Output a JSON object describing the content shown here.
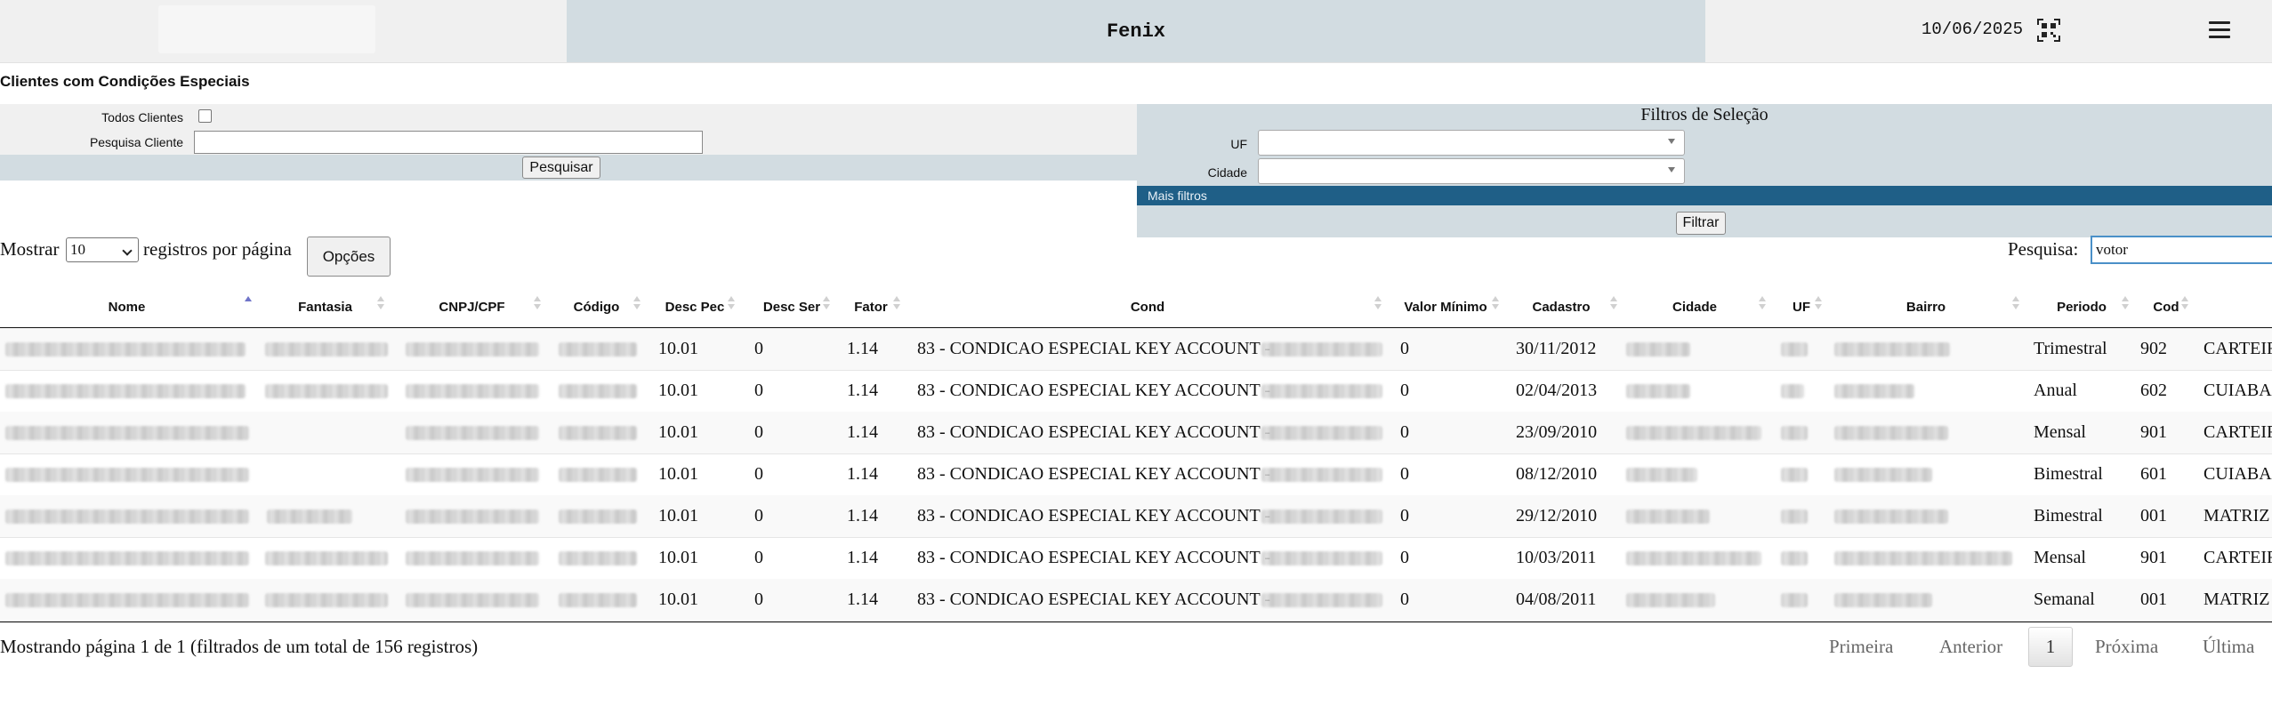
{
  "header": {
    "app_title": "Fenix",
    "date": "10/06/2025"
  },
  "page_title": "Clientes com Condições Especiais",
  "filters_left": {
    "todos_label": "Todos Clientes",
    "pesquisa_label": "Pesquisa Cliente",
    "pesquisa_value": "",
    "pesquisar_button": "Pesquisar"
  },
  "filters_right": {
    "title": "Filtros de Seleção",
    "uf_label": "UF",
    "cidade_label": "Cidade",
    "mais_filtros": "Mais filtros",
    "filtrar_button": "Filtrar"
  },
  "table_controls": {
    "show_prefix": "Mostrar",
    "page_length": "10",
    "show_suffix": "registros por página",
    "options_button": "Opções",
    "search_label": "Pesquisa:",
    "search_value": "votor"
  },
  "table": {
    "columns": [
      "Nome",
      "Fantasia",
      "CNPJ/CPF",
      "Código",
      "Desc Pec",
      "Desc Ser",
      "Fator",
      "Cond",
      "Valor Mínimo",
      "Cadastro",
      "Cidade",
      "UF",
      "Bairro",
      "Periodo",
      "Cod"
    ],
    "sorted_column": "Nome",
    "rows": [
      {
        "desc_pec": "10.01",
        "desc_ser": "0",
        "fator": "1.14",
        "cond": "83 - CONDICAO ESPECIAL KEY ACCOUNT -",
        "valor_minimo": "0",
        "cadastro": "30/11/2012",
        "periodo": "Trimestral",
        "cod": "902",
        "last": "CARTEIRA"
      },
      {
        "desc_pec": "10.01",
        "desc_ser": "0",
        "fator": "1.14",
        "cond": "83 - CONDICAO ESPECIAL KEY ACCOUNT -",
        "valor_minimo": "0",
        "cadastro": "02/04/2013",
        "periodo": "Anual",
        "cod": "602",
        "last": "CUIABA"
      },
      {
        "desc_pec": "10.01",
        "desc_ser": "0",
        "fator": "1.14",
        "cond": "83 - CONDICAO ESPECIAL KEY ACCOUNT -",
        "valor_minimo": "0",
        "cadastro": "23/09/2010",
        "periodo": "Mensal",
        "cod": "901",
        "last": "CARTEIRA"
      },
      {
        "desc_pec": "10.01",
        "desc_ser": "0",
        "fator": "1.14",
        "cond": "83 - CONDICAO ESPECIAL KEY ACCOUNT -",
        "valor_minimo": "0",
        "cadastro": "08/12/2010",
        "periodo": "Bimestral",
        "cod": "601",
        "last": "CUIABA"
      },
      {
        "desc_pec": "10.01",
        "desc_ser": "0",
        "fator": "1.14",
        "cond": "83 - CONDICAO ESPECIAL KEY ACCOUNT -",
        "valor_minimo": "0",
        "cadastro": "29/12/2010",
        "periodo": "Bimestral",
        "cod": "001",
        "last": "MATRIZ"
      },
      {
        "desc_pec": "10.01",
        "desc_ser": "0",
        "fator": "1.14",
        "cond": "83 - CONDICAO ESPECIAL KEY ACCOUNT -",
        "valor_minimo": "0",
        "cadastro": "10/03/2011",
        "periodo": "Mensal",
        "cod": "901",
        "last": "CARTEIRA"
      },
      {
        "desc_pec": "10.01",
        "desc_ser": "0",
        "fator": "1.14",
        "cond": "83 - CONDICAO ESPECIAL KEY ACCOUNT -",
        "valor_minimo": "0",
        "cadastro": "04/08/2011",
        "periodo": "Semanal",
        "cod": "001",
        "last": "MATRIZ"
      }
    ]
  },
  "footer": {
    "info": "Mostrando página 1 de 1 (filtrados de um total de 156 registros)",
    "first": "Primeira",
    "previous": "Anterior",
    "current": "1",
    "next": "Próxima",
    "last": "Última"
  }
}
